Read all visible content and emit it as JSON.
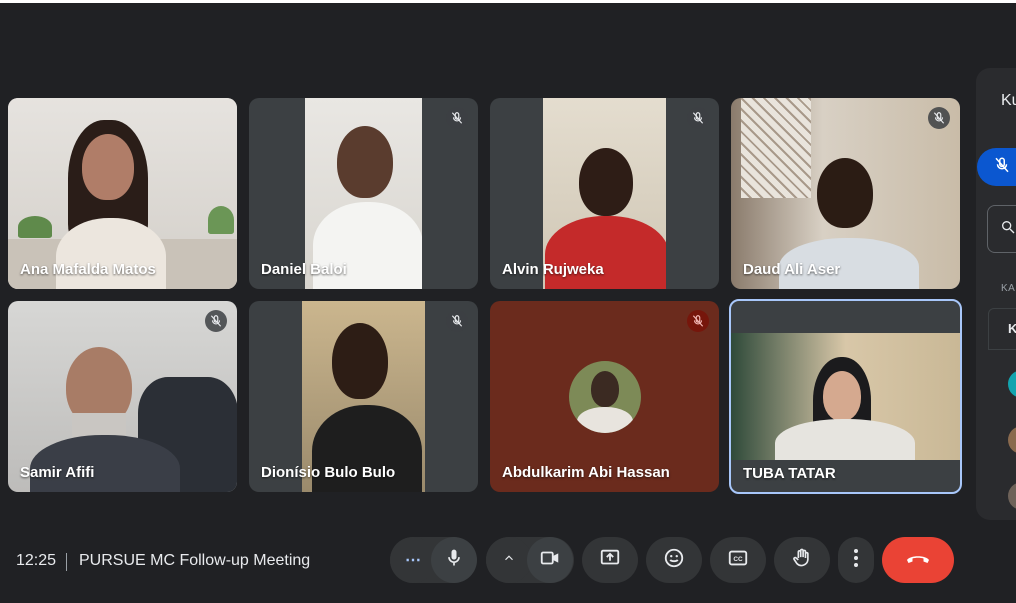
{
  "participants": [
    {
      "name": "Ana Mafalda Matos",
      "muted": false
    },
    {
      "name": "Daniel Baloi",
      "muted": true
    },
    {
      "name": "Alvin Rujweka",
      "muted": true
    },
    {
      "name": "Daud Ali Aser",
      "muted": true
    },
    {
      "name": "Samir Afifi",
      "muted": true
    },
    {
      "name": "Dionísio Bulo Bulo",
      "muted": true
    },
    {
      "name": "Abdulkarim Abi Hassan",
      "muted": true
    },
    {
      "name": "TUBA TATAR",
      "muted": false,
      "self": true
    }
  ],
  "meeting": {
    "time": "12:25",
    "title": "PURSUE MC Follow-up Meeting"
  },
  "controls": {
    "more_label": "⋯",
    "icons": [
      "more-options-icon",
      "microphone-icon",
      "chevron-up-icon",
      "camera-icon",
      "present-screen-icon",
      "emoji-icon",
      "captions-icon",
      "raise-hand-icon",
      "more-vert-icon",
      "hang-up-icon"
    ]
  },
  "side_panel": {
    "title_partial": "Ku",
    "section_label_partial": "KA",
    "box_label_partial": "K"
  },
  "colors": {
    "background": "#202124",
    "hangup": "#ea4335",
    "self_border": "#a8c7fa",
    "mute_active": "#0b57d0"
  }
}
